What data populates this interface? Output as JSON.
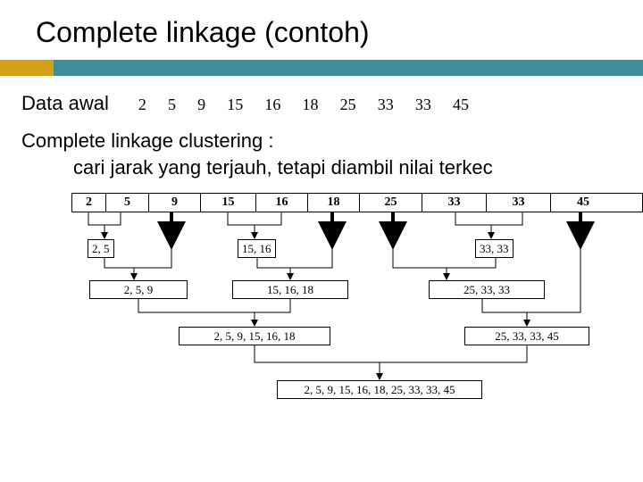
{
  "title": "Complete linkage (contoh)",
  "data_label": "Data awal",
  "data_values": [
    "2",
    "5",
    "9",
    "15",
    "16",
    "18",
    "25",
    "33",
    "33",
    "45"
  ],
  "method_line1": "Complete linkage clustering :",
  "method_line2": "cari jarak yang terjauh, tetapi  diambil nilai terkec",
  "top_cells": [
    "2",
    "5",
    "9",
    "15",
    "16",
    "18",
    "25",
    "33",
    "33",
    "45"
  ],
  "boxes": {
    "b25": "2, 5",
    "b1516": "15, 16",
    "b3333": "33, 33",
    "b259": "2, 5, 9",
    "b151618": "15, 16, 18",
    "b253333": "25, 33, 33",
    "b259151618": "2, 5, 9, 15, 16, 18",
    "b25333345": "25, 33, 33, 45",
    "final": "2, 5, 9, 15, 16, 18, 25, 33, 33, 45"
  }
}
